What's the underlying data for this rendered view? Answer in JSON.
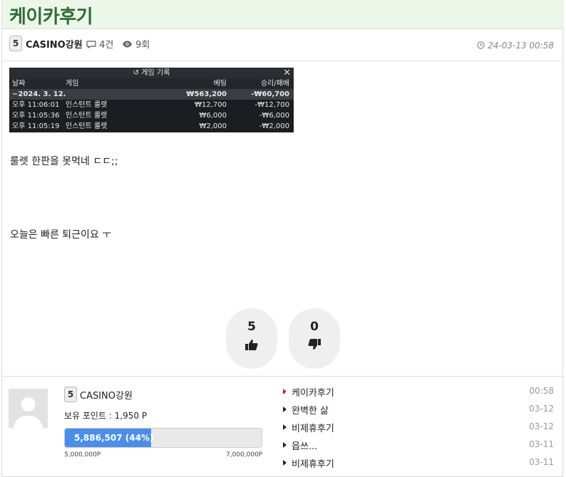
{
  "post": {
    "title": "케이카후기",
    "author": "CASINO강원",
    "level": "5",
    "comment_count": "4건",
    "view_count": "9회",
    "date": "24-03-13 00:58",
    "body_line1": "룰렛 한판을 못먹네 ㄷㄷ;;",
    "body_line2": "오늘은 빠른 퇴근이요 ㅜ"
  },
  "game_record": {
    "title": "게임 기록",
    "columns": [
      "날짜",
      "게임",
      "베팅",
      "승리/패배"
    ],
    "total": {
      "date": "−2024. 3. 12.",
      "game": "",
      "bet": "₩563,200",
      "result": "-₩60,700"
    },
    "rows": [
      {
        "date": "오후 11:06:01",
        "game": "인스턴트 룰렛",
        "bet": "₩12,700",
        "result": "-₩12,700"
      },
      {
        "date": "오후 11:05:36",
        "game": "인스턴트 룰렛",
        "bet": "₩6,000",
        "result": "-₩6,000"
      },
      {
        "date": "오후 11:05:19",
        "game": "인스턴트 룰렛",
        "bet": "₩2,000",
        "result": "-₩2,000"
      }
    ]
  },
  "votes": {
    "up": "5",
    "down": "0"
  },
  "profile": {
    "name": "CASINO강원",
    "level": "5",
    "points": "보유 포인트 : 1,950 P",
    "progress_text": "5,886,507 (44%)",
    "progress_fraction": 0.44,
    "range_min": "5,000,000P",
    "range_max": "7,000,000P"
  },
  "related": [
    {
      "title": "케이카후기",
      "date": "00:58"
    },
    {
      "title": "완벽한 삶",
      "date": "03-12"
    },
    {
      "title": "비제휴후기",
      "date": "03-12"
    },
    {
      "title": "읍쓰...",
      "date": "03-11"
    },
    {
      "title": "비제휴후기",
      "date": "03-11"
    }
  ],
  "colors": {
    "title_green": "#2f6b35",
    "progress_blue": "#4b8ee8",
    "active_arrow": "#e02020"
  }
}
